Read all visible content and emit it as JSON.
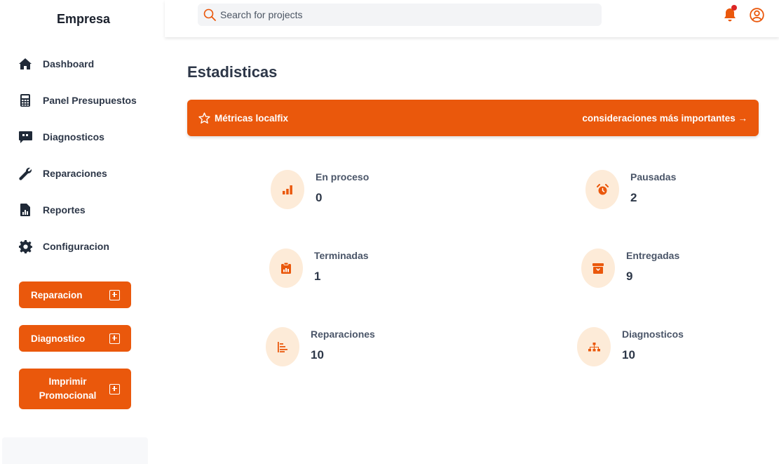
{
  "sidebar": {
    "brand": "Empresa",
    "items": [
      {
        "label": "Dashboard",
        "icon": "home-icon"
      },
      {
        "label": "Panel Presupuestos",
        "icon": "calculator-icon"
      },
      {
        "label": "Diagnosticos",
        "icon": "quote-bubble-icon"
      },
      {
        "label": "Reparaciones",
        "icon": "wrench-icon"
      },
      {
        "label": "Reportes",
        "icon": "report-file-icon"
      },
      {
        "label": "Configuracion",
        "icon": "gear-icon"
      }
    ],
    "buttons": [
      {
        "label": "Reparacion"
      },
      {
        "label": "Diagnostico"
      },
      {
        "label": "Imprimir Promocional"
      }
    ]
  },
  "topbar": {
    "search_placeholder": "Search for projects"
  },
  "main": {
    "title": "Estadisticas",
    "banner": {
      "left_label": "Métricas localfix",
      "right_label": "consideraciones más importantes →"
    },
    "stats": [
      {
        "label": "En proceso",
        "value": "0",
        "icon": "bar-chart-icon"
      },
      {
        "label": "Pausadas",
        "value": "2",
        "icon": "alarm-clock-icon"
      },
      {
        "label": "Terminadas",
        "value": "1",
        "icon": "clipboard-chart-icon"
      },
      {
        "label": "Entregadas",
        "value": "9",
        "icon": "archive-box-icon"
      },
      {
        "label": "Reparaciones",
        "value": "10",
        "icon": "list-tree-icon"
      },
      {
        "label": "Diagnosticos",
        "value": "10",
        "icon": "sitemap-icon"
      }
    ]
  },
  "colors": {
    "accent": "#ea580c",
    "icon_bg": "#fdebd8",
    "notification_dot": "#dc2626",
    "text_dark": "#2d3748"
  }
}
